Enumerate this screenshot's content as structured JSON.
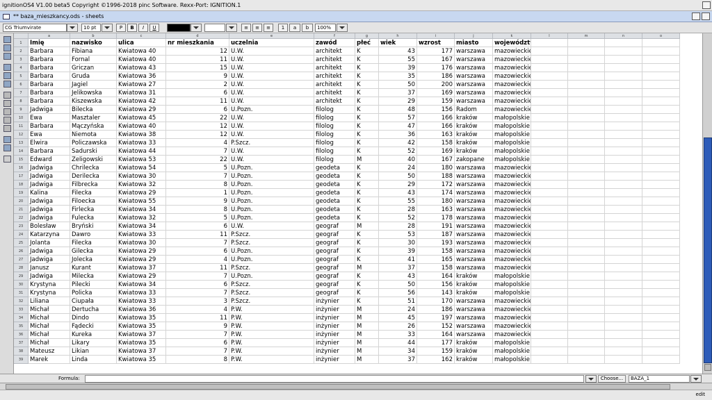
{
  "app": {
    "title": "ignitionOS4  V1.00 beta5   Copyright ©1996-2018 pinc Software.   Rexx-Port: IGNITION.1"
  },
  "window": {
    "title": "** baza_mieszkancy.ods - sheets"
  },
  "toolbar": {
    "font": "CG Triumvirate",
    "size": "10 pt",
    "bold": "B",
    "italic": "I",
    "underline": "U",
    "pblock": "P",
    "zoom": "100%",
    "fmt1": "1",
    "fmt2": "a",
    "fmt3": "b"
  },
  "formula": {
    "label": "Formula:",
    "value": "",
    "choose": "Choose...",
    "cell_name": "BAZA_1"
  },
  "status": {
    "mode": "edit"
  },
  "columns": [
    "a",
    "b",
    "c",
    "d",
    "e",
    "f",
    "g",
    "h",
    "i",
    "j",
    "k",
    "l",
    "m",
    "n",
    "o"
  ],
  "header_row": [
    "Imię",
    "nazwisko",
    "ulica",
    "nr mieszkania",
    "uczelnia",
    "zawód",
    "płeć",
    "wiek",
    "wzrost",
    "miasto",
    "województwo"
  ],
  "rows": [
    [
      "Barbara",
      "Fibiana",
      "Kwiatowa 40",
      "12",
      "U.W.",
      "architekt",
      "K",
      "43",
      "177",
      "warszawa",
      "mazowieckie"
    ],
    [
      "Barbara",
      "Fornal",
      "Kwiatowa 40",
      "11",
      "U.W.",
      "architekt",
      "K",
      "55",
      "167",
      "warszawa",
      "mazowieckie"
    ],
    [
      "Barbara",
      "Griczan",
      "Kwiatowa 43",
      "15",
      "U.W.",
      "architekt",
      "K",
      "39",
      "176",
      "warszawa",
      "mazowieckie"
    ],
    [
      "Barbara",
      "Gruda",
      "Kwiatowa 36",
      "9",
      "U.W.",
      "architekt",
      "K",
      "35",
      "186",
      "warszawa",
      "mazowieckie"
    ],
    [
      "Barbara",
      "Jagiel",
      "Kwiatowa 27",
      "2",
      "U.W.",
      "architekt",
      "K",
      "50",
      "200",
      "warszawa",
      "mazowieckie"
    ],
    [
      "Barbara",
      "Jelikowska",
      "Kwiatowa 31",
      "6",
      "U.W.",
      "architekt",
      "K",
      "37",
      "169",
      "warszawa",
      "mazowieckie"
    ],
    [
      "Barbara",
      "Kiszewska",
      "Kwiatowa 42",
      "11",
      "U.W.",
      "architekt",
      "K",
      "29",
      "159",
      "warszawa",
      "mazowieckie"
    ],
    [
      "Jadwiga",
      "Bilecka",
      "Kwiatowa 29",
      "6",
      "U.Pozn.",
      "filolog",
      "K",
      "48",
      "156",
      "Radom",
      "mazowieckie"
    ],
    [
      "Ewa",
      "Masztaler",
      "Kwiatowa 45",
      "22",
      "U.W.",
      "filolog",
      "K",
      "57",
      "166",
      "kraków",
      "małopolskie"
    ],
    [
      "Barbara",
      "Mączyńska",
      "Kwiatowa 40",
      "12",
      "U.W.",
      "filolog",
      "K",
      "47",
      "166",
      "kraków",
      "małopolskie"
    ],
    [
      "Ewa",
      "Niemota",
      "Kwiatowa 38",
      "12",
      "U.W.",
      "filolog",
      "K",
      "36",
      "163",
      "kraków",
      "małopolskie"
    ],
    [
      "Elwira",
      "Policzawska",
      "Kwiatowa 33",
      "4",
      "P.Szcz.",
      "filolog",
      "K",
      "42",
      "158",
      "kraków",
      "małopolskie"
    ],
    [
      "Barbara",
      "Sadurski",
      "Kwiatowa 44",
      "7",
      "U.W.",
      "filolog",
      "K",
      "52",
      "169",
      "kraków",
      "małopolskie"
    ],
    [
      "Edward",
      "Zeligowski",
      "Kwiatowa 53",
      "22",
      "U.W.",
      "filolog",
      "M",
      "40",
      "167",
      "zakopane",
      "małopolskie"
    ],
    [
      "Jadwiga",
      "Chrilecka",
      "Kwiatowa 54",
      "5",
      "U.Pozn.",
      "geodeta",
      "K",
      "24",
      "180",
      "warszawa",
      "mazowieckie"
    ],
    [
      "Jadwiga",
      "Derilecka",
      "Kwiatowa 30",
      "7",
      "U.Pozn.",
      "geodeta",
      "K",
      "50",
      "188",
      "warszawa",
      "mazowieckie"
    ],
    [
      "Jadwiga",
      "Filbrecka",
      "Kwiatowa 32",
      "8",
      "U.Pozn.",
      "geodeta",
      "K",
      "29",
      "172",
      "warszawa",
      "mazowieckie"
    ],
    [
      "Kalina",
      "Filecka",
      "Kwiatowa 29",
      "1",
      "U.Pozn.",
      "geodeta",
      "K",
      "43",
      "174",
      "warszawa",
      "mazowieckie"
    ],
    [
      "Jadwiga",
      "Filoecka",
      "Kwiatowa 55",
      "9",
      "U.Pozn.",
      "geodeta",
      "K",
      "55",
      "180",
      "warszawa",
      "mazowieckie"
    ],
    [
      "Jadwiga",
      "Firlecka",
      "Kwiatowa 34",
      "8",
      "U.Pozn.",
      "geodeta",
      "K",
      "28",
      "163",
      "warszawa",
      "mazowieckie"
    ],
    [
      "Jadwiga",
      "Fulecka",
      "Kwiatowa 32",
      "5",
      "U.Pozn.",
      "geodeta",
      "K",
      "52",
      "178",
      "warszawa",
      "mazowieckie"
    ],
    [
      "Bolesław",
      "Bryński",
      "Kwiatowa 34",
      "6",
      "U.W.",
      "geograf",
      "M",
      "28",
      "191",
      "warszawa",
      "mazowieckie"
    ],
    [
      "Katarzyna",
      "Dawro",
      "Kwiatowa 33",
      "11",
      "P.Szcz.",
      "geograf",
      "K",
      "53",
      "187",
      "warszawa",
      "mazowieckie"
    ],
    [
      "Jolanta",
      "Filecka",
      "Kwiatowa 30",
      "7",
      "P.Szcz.",
      "geograf",
      "K",
      "30",
      "193",
      "warszawa",
      "mazowieckie"
    ],
    [
      "Jadwiga",
      "Gilecka",
      "Kwiatowa 29",
      "6",
      "U.Pozn.",
      "geograf",
      "K",
      "39",
      "158",
      "warszawa",
      "mazowieckie"
    ],
    [
      "Jadwiga",
      "Jolecka",
      "Kwiatowa 29",
      "4",
      "U.Pozn.",
      "geograf",
      "K",
      "41",
      "165",
      "warszawa",
      "mazowieckie"
    ],
    [
      "Janusz",
      "Kurant",
      "Kwiatowa 37",
      "11",
      "P.Szcz.",
      "geograf",
      "M",
      "37",
      "158",
      "warszawa",
      "mazowieckie"
    ],
    [
      "Jadwiga",
      "Milecka",
      "Kwiatowa 29",
      "7",
      "U.Pozn.",
      "geograf",
      "K",
      "43",
      "164",
      "kraków",
      "małopolskie"
    ],
    [
      "Krystyna",
      "Pilecki",
      "Kwiatowa 34",
      "6",
      "P.Szcz.",
      "geograf",
      "K",
      "50",
      "156",
      "kraków",
      "małopolskie"
    ],
    [
      "Krystyna",
      "Policka",
      "Kwiatowa 33",
      "7",
      "P.Szcz.",
      "geograf",
      "K",
      "56",
      "143",
      "kraków",
      "małopolskie"
    ],
    [
      "Liliana",
      "Ciupała",
      "Kwiatowa 33",
      "3",
      "P.Szcz.",
      "inżynier",
      "K",
      "51",
      "170",
      "warszawa",
      "mazowieckie"
    ],
    [
      "Michał",
      "Dertucha",
      "Kwiatowa 36",
      "4",
      "P.W.",
      "inżynier",
      "M",
      "24",
      "186",
      "warszawa",
      "mazowieckie"
    ],
    [
      "Michał",
      "Dindo",
      "Kwiatowa 35",
      "11",
      "P.W.",
      "inżynier",
      "M",
      "45",
      "197",
      "warszawa",
      "mazowieckie"
    ],
    [
      "Michał",
      "Fądecki",
      "Kwiatowa 35",
      "9",
      "P.W.",
      "inżynier",
      "M",
      "26",
      "152",
      "warszawa",
      "mazowieckie"
    ],
    [
      "Michał",
      "Kureka",
      "Kwiatowa 37",
      "7",
      "P.W.",
      "inżynier",
      "M",
      "33",
      "164",
      "warszawa",
      "mazowieckie"
    ],
    [
      "Michał",
      "Likary",
      "Kwiatowa 35",
      "6",
      "P.W.",
      "inżynier",
      "M",
      "44",
      "177",
      "kraków",
      "małopolskie"
    ],
    [
      "Mateusz",
      "Likian",
      "Kwiatowa 37",
      "7",
      "P.W.",
      "inżynier",
      "M",
      "34",
      "159",
      "kraków",
      "małopolskie"
    ],
    [
      "Marek",
      "Linda",
      "Kwiatowa 35",
      "8",
      "P.W.",
      "inżynier",
      "M",
      "37",
      "162",
      "kraków",
      "małopolskie"
    ]
  ]
}
